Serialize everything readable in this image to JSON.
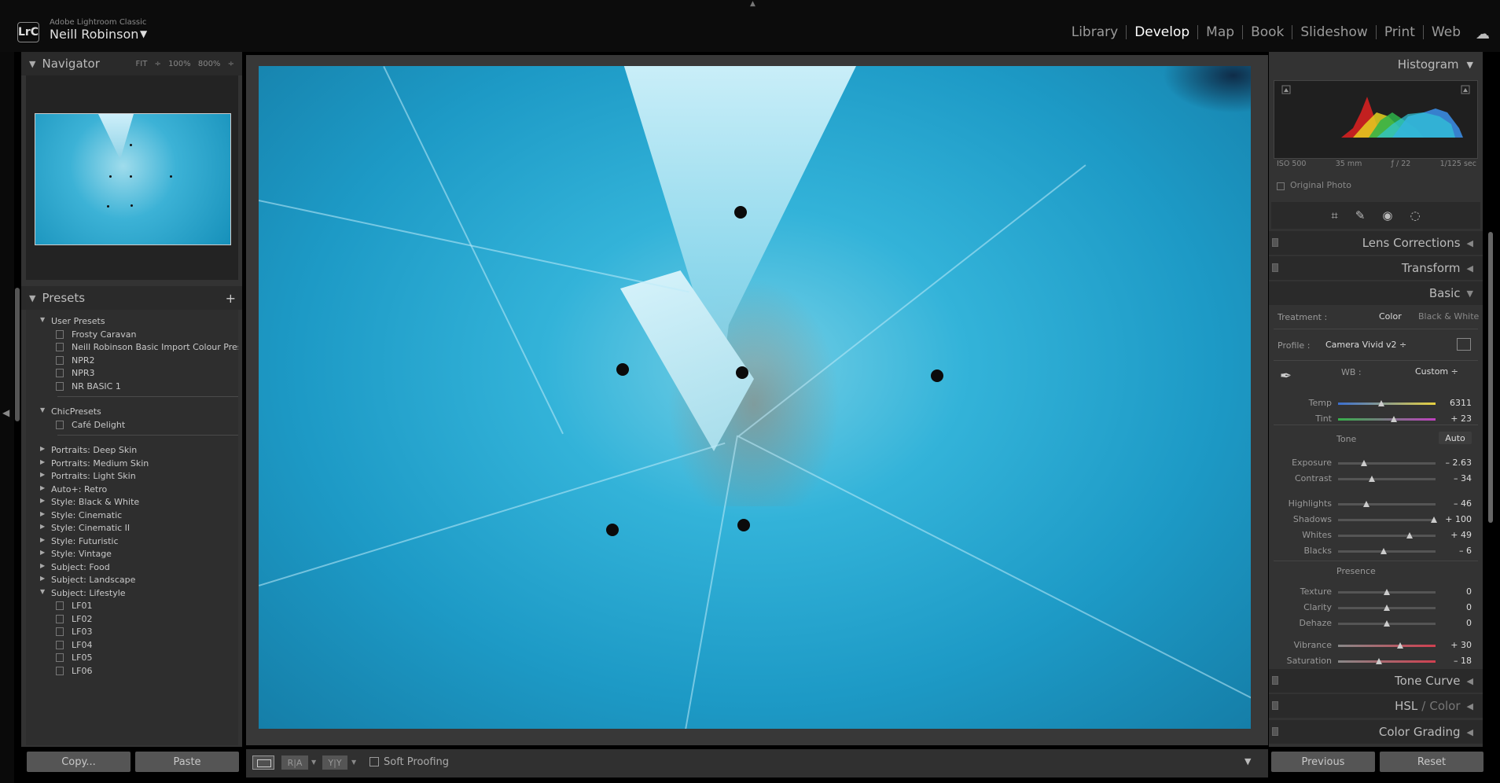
{
  "app": {
    "name": "Adobe Lightroom Classic",
    "logo_text": "LrC",
    "user": "Neill Robinson",
    "user_arrow": "▼",
    "top_arrow": "▲"
  },
  "modules": [
    "Library",
    "Develop",
    "Map",
    "Book",
    "Slideshow",
    "Print",
    "Web"
  ],
  "active_module": "Develop",
  "navigator": {
    "title": "Navigator",
    "zoom_fit": "FIT ÷",
    "zoom_100": "100%",
    "zoom_800": "800% ÷"
  },
  "presets": {
    "title": "Presets",
    "add": "+",
    "items": [
      {
        "type": "group-open",
        "label": "User Presets"
      },
      {
        "type": "preset",
        "label": "Frosty Caravan"
      },
      {
        "type": "preset",
        "label": "Neill Robinson Basic Import Colour Pres..."
      },
      {
        "type": "preset",
        "label": "NPR2"
      },
      {
        "type": "preset",
        "label": "NPR3"
      },
      {
        "type": "preset",
        "label": "NR BASIC 1"
      },
      {
        "type": "group-open",
        "label": "ChicPresets"
      },
      {
        "type": "preset",
        "label": "Café Delight"
      },
      {
        "type": "group",
        "label": "Portraits: Deep Skin"
      },
      {
        "type": "group",
        "label": "Portraits: Medium Skin"
      },
      {
        "type": "group",
        "label": "Portraits: Light Skin"
      },
      {
        "type": "group",
        "label": "Auto+: Retro"
      },
      {
        "type": "group",
        "label": "Style: Black & White"
      },
      {
        "type": "group",
        "label": "Style: Cinematic"
      },
      {
        "type": "group",
        "label": "Style: Cinematic II"
      },
      {
        "type": "group",
        "label": "Style: Futuristic"
      },
      {
        "type": "group",
        "label": "Style: Vintage"
      },
      {
        "type": "group",
        "label": "Subject: Food"
      },
      {
        "type": "group",
        "label": "Subject: Landscape"
      },
      {
        "type": "group-open",
        "label": "Subject: Lifestyle"
      },
      {
        "type": "preset",
        "label": "LF01"
      },
      {
        "type": "preset",
        "label": "LF02"
      },
      {
        "type": "preset",
        "label": "LF03"
      },
      {
        "type": "preset",
        "label": "LF04"
      },
      {
        "type": "preset",
        "label": "LF05"
      },
      {
        "type": "preset",
        "label": "LF06"
      }
    ]
  },
  "left_buttons": {
    "copy": "Copy...",
    "paste": "Paste"
  },
  "toolbar": {
    "ra": "R|A",
    "yy": "Y|Y",
    "soft_proofing": "Soft Proofing",
    "soft_proofing_checked": false
  },
  "histogram": {
    "title": "Histogram",
    "iso": "ISO 500",
    "focal": "35 mm",
    "aperture": "ƒ / 22",
    "shutter": "1/125 sec",
    "original_photo": "Original Photo"
  },
  "sections": {
    "lens_corrections": "Lens Corrections",
    "transform": "Transform",
    "basic": "Basic",
    "tone_curve": "Tone Curve",
    "hsl": "HSL",
    "hsl_color": "Color",
    "color_grading": "Color Grading"
  },
  "basic": {
    "treatment_label": "Treatment :",
    "treatment_color": "Color",
    "treatment_bw": "Black & White",
    "profile_label": "Profile :",
    "profile_value": "Camera Vivid v2 ÷",
    "wb_label": "WB :",
    "wb_value": "Custom ÷",
    "tone_label": "Tone",
    "auto": "Auto",
    "presence_label": "Presence",
    "sliders": [
      {
        "label": "Temp",
        "value": "6311",
        "level": 0.44,
        "track": "temp"
      },
      {
        "label": "Tint",
        "value": "+ 23",
        "level": 0.57,
        "track": "tint"
      },
      {
        "label": "Exposure",
        "value": "– 2.63",
        "level": 0.27,
        "track": "gray"
      },
      {
        "label": "Contrast",
        "value": "– 34",
        "level": 0.35,
        "track": "gray"
      },
      {
        "label": "Highlights",
        "value": "– 46",
        "level": 0.29,
        "track": "gray"
      },
      {
        "label": "Shadows",
        "value": "+ 100",
        "level": 0.98,
        "track": "gray"
      },
      {
        "label": "Whites",
        "value": "+ 49",
        "level": 0.73,
        "track": "gray"
      },
      {
        "label": "Blacks",
        "value": "– 6",
        "level": 0.47,
        "track": "gray"
      },
      {
        "label": "Texture",
        "value": "0",
        "level": 0.5,
        "track": "gray"
      },
      {
        "label": "Clarity",
        "value": "0",
        "level": 0.5,
        "track": "gray"
      },
      {
        "label": "Dehaze",
        "value": "0",
        "level": 0.5,
        "track": "gray"
      },
      {
        "label": "Vibrance",
        "value": "+ 30",
        "level": 0.64,
        "track": "vib"
      },
      {
        "label": "Saturation",
        "value": "– 18",
        "level": 0.42,
        "track": "sat"
      }
    ]
  },
  "right_buttons": {
    "previous": "Previous",
    "reset": "Reset"
  },
  "colors": {
    "accent_photo": "#2bb0d8",
    "panel": "#333333",
    "header": "#2a2a2a"
  }
}
